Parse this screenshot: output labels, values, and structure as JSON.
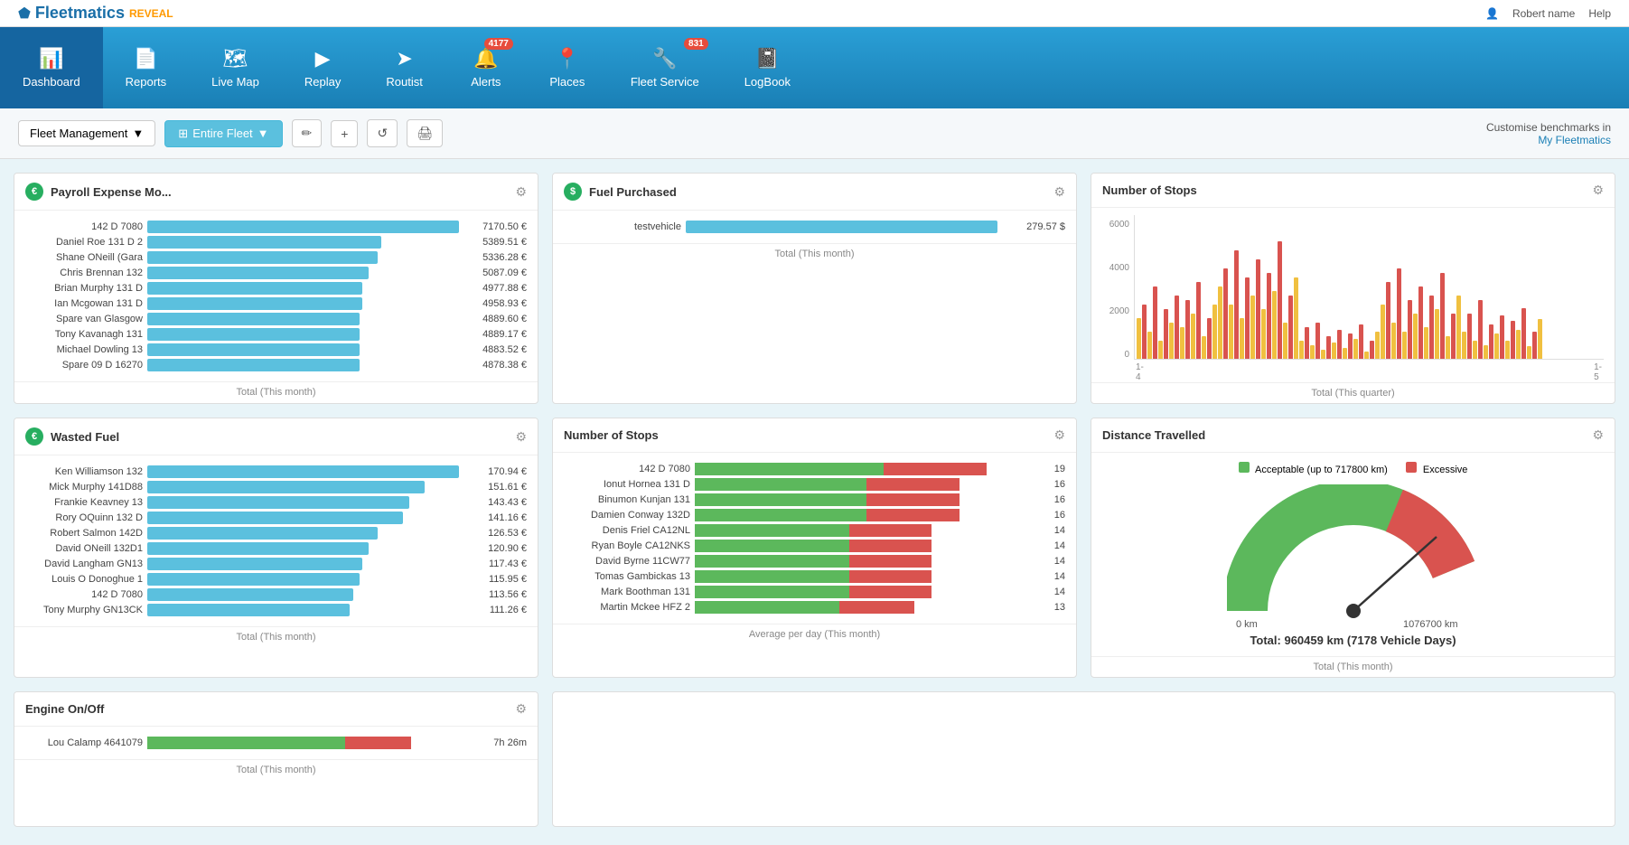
{
  "header": {
    "logo": "Fleetmatics",
    "logo_reveal": "REVEAL",
    "user_name": "Robert name",
    "help_label": "Help"
  },
  "nav": {
    "items": [
      {
        "id": "dashboard",
        "label": "Dashboard",
        "icon": "📊",
        "active": true,
        "badge": null
      },
      {
        "id": "reports",
        "label": "Reports",
        "icon": "📄",
        "active": false,
        "badge": null
      },
      {
        "id": "livemap",
        "label": "Live Map",
        "icon": "🗺",
        "active": false,
        "badge": null
      },
      {
        "id": "replay",
        "label": "Replay",
        "icon": "▶",
        "active": false,
        "badge": null
      },
      {
        "id": "routist",
        "label": "Routist",
        "icon": "➤",
        "active": false,
        "badge": null
      },
      {
        "id": "alerts",
        "label": "Alerts",
        "icon": "🔔",
        "active": false,
        "badge": "4177"
      },
      {
        "id": "places",
        "label": "Places",
        "icon": "📍",
        "active": false,
        "badge": null
      },
      {
        "id": "fleetservice",
        "label": "Fleet Service",
        "icon": "🔧",
        "active": false,
        "badge": "831"
      },
      {
        "id": "logbook",
        "label": "LogBook",
        "icon": "📓",
        "active": false,
        "badge": null
      }
    ]
  },
  "toolbar": {
    "fleet_management_label": "Fleet Management",
    "entire_fleet_label": "Entire Fleet",
    "customize_text": "Customise benchmarks in",
    "my_fleetmatics_label": "My Fleetmatics"
  },
  "payroll_widget": {
    "title": "Payroll Expense Mo...",
    "footer": "Total (This month)",
    "rows": [
      {
        "label": "142 D 7080",
        "value": "7170.50 €",
        "pct": 100
      },
      {
        "label": "Daniel Roe 131 D 2",
        "value": "5389.51 €",
        "pct": 75
      },
      {
        "label": "Shane ONeill (Gara",
        "value": "5336.28 €",
        "pct": 74
      },
      {
        "label": "Chris Brennan 132",
        "value": "5087.09 €",
        "pct": 71
      },
      {
        "label": "Brian Murphy 131 D",
        "value": "4977.88 €",
        "pct": 69
      },
      {
        "label": "Ian Mcgowan 131 D",
        "value": "4958.93 €",
        "pct": 69
      },
      {
        "label": "Spare van Glasgow",
        "value": "4889.60 €",
        "pct": 68
      },
      {
        "label": "Tony Kavanagh 131",
        "value": "4889.17 €",
        "pct": 68
      },
      {
        "label": "Michael Dowling 13",
        "value": "4883.52 €",
        "pct": 68
      },
      {
        "label": "Spare 09 D 16270",
        "value": "4878.38 €",
        "pct": 68
      }
    ]
  },
  "fuel_widget": {
    "title": "Fuel Purchased",
    "footer": "Total (This month)",
    "rows": [
      {
        "label": "testvehicle",
        "value": "279.57 $",
        "pct": 100
      }
    ]
  },
  "num_stops_chart": {
    "title": "Number of Stops",
    "footer": "Total (This quarter)",
    "y_labels": [
      "6000",
      "4000",
      "2000",
      "0"
    ],
    "x_labels": [
      "1-4",
      "1-5"
    ]
  },
  "wasted_fuel_widget": {
    "title": "Wasted Fuel",
    "footer": "Total (This month)",
    "rows": [
      {
        "label": "Ken Williamson 132",
        "value": "170.94 €",
        "pct": 100
      },
      {
        "label": "Mick Murphy 141D88",
        "value": "151.61 €",
        "pct": 89
      },
      {
        "label": "Frankie Keavney 13",
        "value": "143.43 €",
        "pct": 84
      },
      {
        "label": "Rory OQuinn 132 D",
        "value": "141.16 €",
        "pct": 82
      },
      {
        "label": "Robert Salmon 142D",
        "value": "126.53 €",
        "pct": 74
      },
      {
        "label": "David ONeill 132D1",
        "value": "120.90 €",
        "pct": 71
      },
      {
        "label": "David Langham GN13",
        "value": "117.43 €",
        "pct": 69
      },
      {
        "label": "Louis O Donoghue 1",
        "value": "115.95 €",
        "pct": 68
      },
      {
        "label": "142 D 7080",
        "value": "113.56 €",
        "pct": 66
      },
      {
        "label": "Tony Murphy GN13CK",
        "value": "111.26 €",
        "pct": 65
      }
    ]
  },
  "num_stops_widget": {
    "title": "Number of Stops",
    "footer": "Average per day (This month)",
    "rows": [
      {
        "label": "142 D 7080",
        "green_pct": 55,
        "red_pct": 30,
        "value": "19"
      },
      {
        "label": "Ionut Hornea 131 D",
        "green_pct": 50,
        "red_pct": 27,
        "value": "16"
      },
      {
        "label": "Binumon Kunjan 131",
        "green_pct": 50,
        "red_pct": 27,
        "value": "16"
      },
      {
        "label": "Damien Conway 132D",
        "green_pct": 50,
        "red_pct": 27,
        "value": "16"
      },
      {
        "label": "Denis Friel CA12NL",
        "green_pct": 45,
        "red_pct": 24,
        "value": "14"
      },
      {
        "label": "Ryan Boyle CA12NKS",
        "green_pct": 45,
        "red_pct": 24,
        "value": "14"
      },
      {
        "label": "David Byrne 11CW77",
        "green_pct": 45,
        "red_pct": 24,
        "value": "14"
      },
      {
        "label": "Tomas Gambickas 13",
        "green_pct": 45,
        "red_pct": 24,
        "value": "14"
      },
      {
        "label": "Mark Boothman 131",
        "green_pct": 45,
        "red_pct": 24,
        "value": "14"
      },
      {
        "label": "Martin Mckee HFZ 2",
        "green_pct": 42,
        "red_pct": 22,
        "value": "13"
      }
    ]
  },
  "distance_widget": {
    "title": "Distance Travelled",
    "footer": "Total (This month)",
    "legend_acceptable": "Acceptable (up to 717800 km)",
    "legend_excessive": "Excessive",
    "total_text": "Total: 960459 km (7178 Vehicle Days)",
    "gauge_value": 0.72,
    "min_label": "0 km",
    "max_label": "1076700 km"
  },
  "engine_widget": {
    "title": "Engine On/Off",
    "footer": "Total (This month)",
    "rows": [
      {
        "label": "Lou Calamp 4641079",
        "green_pct": 60,
        "red_pct": 20,
        "value": "7h 26m"
      }
    ]
  }
}
